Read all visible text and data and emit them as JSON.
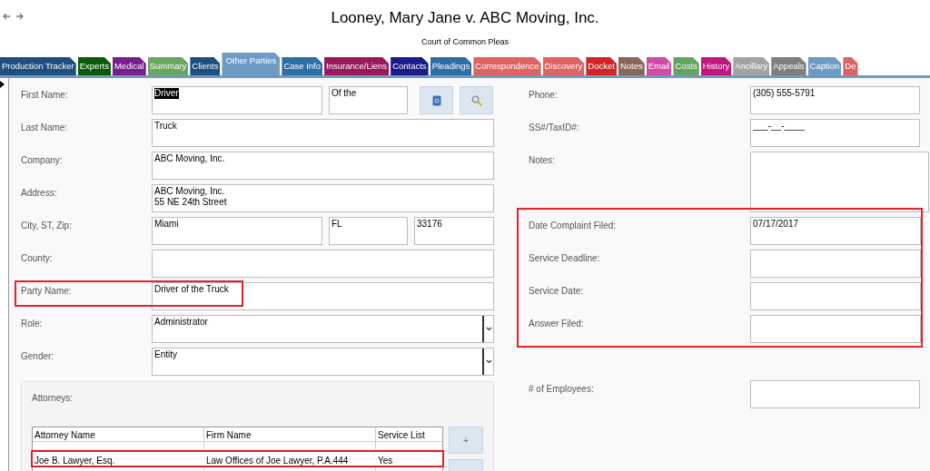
{
  "header": {
    "title": "Looney, Mary Jane v. ABC Moving, Inc.",
    "subtitle": "Court of Common Pleas"
  },
  "tabs": [
    {
      "label": "Production Tracker",
      "color": "#1f4f7f",
      "selected": false
    },
    {
      "label": "Experts",
      "color": "#0b5a0b",
      "selected": false
    },
    {
      "label": "Medical",
      "color": "#7a1d8f",
      "selected": false
    },
    {
      "label": "Summary",
      "color": "#6aa760",
      "selected": false
    },
    {
      "label": "Clients",
      "color": "#1d4f80",
      "selected": false
    },
    {
      "label": "Other Parties",
      "color": "#6d9bc6",
      "selected": true
    },
    {
      "label": "Case Info",
      "color": "#2e6ea8",
      "selected": false
    },
    {
      "label": "Insurance/Liens",
      "color": "#99195c",
      "selected": false
    },
    {
      "label": "Contacts",
      "color": "#1b1b8a",
      "selected": false
    },
    {
      "label": "Pleadings",
      "color": "#2e6ea8",
      "selected": false
    },
    {
      "label": "Correspondence",
      "color": "#e06363",
      "selected": false
    },
    {
      "label": "Discovery",
      "color": "#e06363",
      "selected": false
    },
    {
      "label": "Docket",
      "color": "#d22626",
      "selected": false
    },
    {
      "label": "Notes",
      "color": "#8a6559",
      "selected": false
    },
    {
      "label": "Email",
      "color": "#d24aa6",
      "selected": false
    },
    {
      "label": "Costs",
      "color": "#61a561",
      "selected": false
    },
    {
      "label": "History",
      "color": "#c1177d",
      "selected": false
    },
    {
      "label": "Ancillary",
      "color": "#a3a3a3",
      "selected": false
    },
    {
      "label": "Appeals",
      "color": "#7f7f7f",
      "selected": false
    },
    {
      "label": "Caption",
      "color": "#6d9bc6",
      "selected": false
    },
    {
      "label": "De",
      "color": "#e06363",
      "selected": false
    }
  ],
  "left_fields": [
    {
      "kind": "name",
      "label": "First Name:",
      "highlighted": false,
      "inputs": [
        {
          "value": "Driver",
          "text_selected": true
        },
        {
          "value": "Of the",
          "text_selected": false
        }
      ]
    },
    {
      "kind": "text",
      "label": "Last Name:",
      "highlighted": false,
      "inputs": [
        {
          "value": "Truck",
          "text_selected": false
        }
      ]
    },
    {
      "kind": "text",
      "label": "Company:",
      "highlighted": false,
      "inputs": [
        {
          "value": "ABC Moving, Inc.",
          "text_selected": false
        }
      ]
    },
    {
      "kind": "text",
      "label": "Address:",
      "highlighted": false,
      "inputs": [
        {
          "value": "ABC Moving, Inc.\n55 NE 24th Street",
          "text_selected": false
        }
      ]
    },
    {
      "kind": "city",
      "label": "City, ST, Zip:",
      "highlighted": false,
      "inputs": [
        {
          "value": "Miami",
          "text_selected": false
        },
        {
          "value": "FL",
          "text_selected": false
        },
        {
          "value": "33176",
          "text_selected": false
        }
      ]
    },
    {
      "kind": "text",
      "label": "County:",
      "highlighted": false
    },
    {
      "kind": "text",
      "label": "Party Name:",
      "highlighted": true,
      "inputs": [
        {
          "value": "Driver of the Truck",
          "text_selected": false
        }
      ]
    },
    {
      "kind": "combo",
      "label": "Role:",
      "highlighted": false,
      "inputs": [
        {
          "value": "Administrator",
          "text_selected": false
        }
      ]
    },
    {
      "kind": "combo",
      "label": "Gender:",
      "highlighted": false,
      "inputs": [
        {
          "value": "Entity",
          "text_selected": false
        }
      ]
    }
  ],
  "right_top": [
    {
      "kind": "text",
      "label": "Phone:",
      "value": "(305) 555-5791"
    },
    {
      "kind": "text",
      "label": "SS#/TaxID#:",
      "value": "___-__-____"
    },
    {
      "kind": "notes",
      "label": "Notes:"
    }
  ],
  "complaint_group": {
    "highlighted": true,
    "fields": [
      {
        "kind": "text",
        "label": "Date Complaint Filed:",
        "value": "07/17/2017"
      },
      {
        "kind": "text",
        "label": "Service Deadline:"
      },
      {
        "kind": "text",
        "label": "Service Date:"
      },
      {
        "kind": "text",
        "label": "Answer Filed:"
      }
    ]
  },
  "right_bottom": [
    {
      "kind": "text",
      "label": "# of Employees:"
    }
  ],
  "attorneys": {
    "label": "Attorneys:",
    "columns": [
      "Attorney Name",
      "Firm Name",
      "Service List"
    ],
    "rows": [
      {
        "cells": [
          "Joe B. Lawyer, Esq.",
          "Law Offices of Joe Lawyer, P.A.444",
          "Yes"
        ],
        "highlighted": true
      }
    ],
    "add_button": "+"
  }
}
